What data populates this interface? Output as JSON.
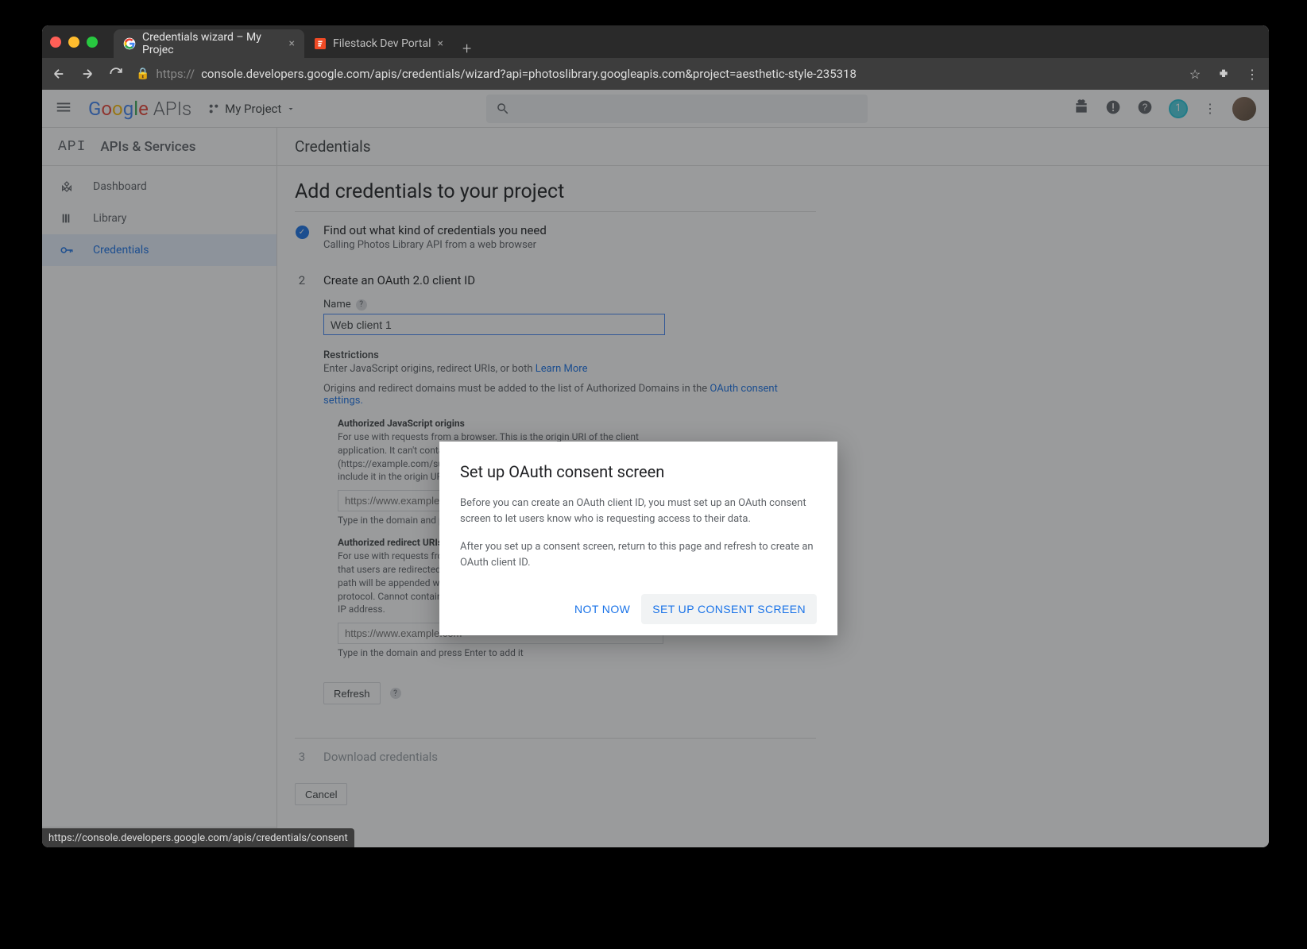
{
  "browser": {
    "tabs": [
      {
        "title": "Credentials wizard – My Projec",
        "active": true
      },
      {
        "title": "Filestack Dev Portal",
        "active": false
      }
    ],
    "url_prefix": "https://",
    "url": "console.developers.google.com/apis/credentials/wizard?api=photoslibrary.googleapis.com&project=aesthetic-style-235318",
    "status_url": "https://console.developers.google.com/apis/credentials/consent"
  },
  "header": {
    "logo_google": "Google",
    "logo_apis": "APIs",
    "project_label": "My Project",
    "notif_count": "1"
  },
  "sidebar": {
    "head_logo": "API",
    "head_label": "APIs & Services",
    "items": [
      {
        "icon": "diamond",
        "label": "Dashboard"
      },
      {
        "icon": "library",
        "label": "Library"
      },
      {
        "icon": "key",
        "label": "Credentials"
      }
    ]
  },
  "main": {
    "page_title": "Credentials",
    "heading": "Add credentials to your project",
    "step1": {
      "title": "Find out what kind of credentials you need",
      "sub": "Calling Photos Library API from a web browser"
    },
    "step2": {
      "num": "2",
      "title": "Create an OAuth 2.0 client ID",
      "name_label": "Name",
      "name_value": "Web client 1",
      "restrictions": "Restrictions",
      "rest_desc": "Enter JavaScript origins, redirect URIs, or both ",
      "learn_more": "Learn More",
      "auth_note": "Origins and redirect domains must be added to the list of Authorized Domains in the ",
      "oauth_link": "OAuth consent settings.",
      "js_origins": {
        "title": "Authorized JavaScript origins",
        "desc": "For use with requests from a browser. This is the origin URI of the client application. It can't contain a wildcard (https://*.example.com) or a path (https://example.com/subdir). If you're using a nonstandard port, you must include it in the origin URI.",
        "placeholder": "https://www.example.com",
        "hint": "Type in the domain and press Enter to add it"
      },
      "redirect": {
        "title": "Authorized redirect URIs",
        "desc": "For use with requests from a web server. This is the path in your application that users are redirected to after they have authenticated with Google. The path will be appended with the authorization code for access. Must have a protocol. Cannot contain URL fragments or relative paths. Cannot be a public IP address.",
        "placeholder": "https://www.example.com",
        "hint": "Type in the domain and press Enter to add it"
      },
      "refresh": "Refresh"
    },
    "step3": {
      "num": "3",
      "title": "Download credentials"
    },
    "cancel": "Cancel"
  },
  "modal": {
    "title": "Set up OAuth consent screen",
    "p1": "Before you can create an OAuth client ID, you must set up an OAuth consent screen to let users know who is requesting access to their data.",
    "p2": "After you set up a consent screen, return to this page and refresh to create an OAuth client ID.",
    "not_now": "NOT NOW",
    "setup": "SET UP CONSENT SCREEN"
  }
}
